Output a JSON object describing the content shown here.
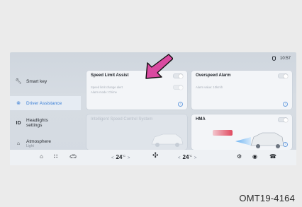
{
  "status": {
    "time": "10:57"
  },
  "sidebar": {
    "items": [
      {
        "icon": "wrench-icon",
        "label": "Smart key",
        "sub": ""
      },
      {
        "icon": "steering-icon",
        "label": "Driver Assistance",
        "sub": ""
      },
      {
        "icon": "headlight-icon",
        "label": "Headlights",
        "label2": "settings",
        "sub": ""
      },
      {
        "icon": "ambient-light-icon",
        "label": "Atmosphere",
        "sub": "Light"
      }
    ]
  },
  "cards": {
    "speed_limit": {
      "title": "Speed Limit Assist",
      "line1": "Speed limit change alert",
      "line2": "Alarm mode: Chime",
      "toggle": "off"
    },
    "overspeed": {
      "title": "Overspeed Alarm",
      "line1": "Alarm value: 10km/h",
      "toggle": "off"
    },
    "isc": {
      "title": "Intelligent Speed Control System"
    },
    "hma": {
      "title": "HMA",
      "toggle": "off"
    }
  },
  "bottombar": {
    "left_temp": "24",
    "right_temp": "24",
    "unit": "°C",
    "left_arrow": "<",
    "right_arrow": ">"
  },
  "caption": "OMT19-4164",
  "colors": {
    "accent": "#3a7fd6",
    "arrow_fill": "#d94aa0"
  }
}
